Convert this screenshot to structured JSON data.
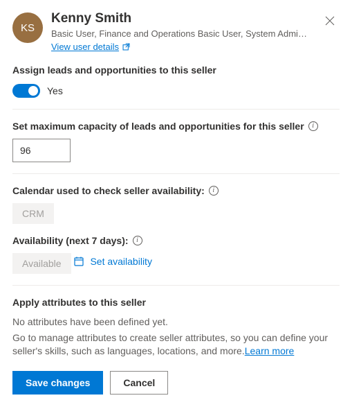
{
  "header": {
    "avatar_initials": "KS",
    "user_name": "Kenny Smith",
    "user_roles": "Basic User, Finance and Operations Basic User, System Administr…",
    "view_details_label": "View user details"
  },
  "assign": {
    "label": "Assign leads and opportunities to this seller",
    "toggle_value": "Yes"
  },
  "capacity": {
    "label": "Set maximum capacity of leads and opportunities for this seller",
    "value": "96"
  },
  "calendar": {
    "label": "Calendar used to check seller availability:",
    "value": "CRM"
  },
  "availability": {
    "label": "Availability (next 7 days):",
    "value": "Available",
    "set_label": "Set availability"
  },
  "attributes": {
    "label": "Apply attributes to this seller",
    "empty_text": "No attributes have been defined yet.",
    "help_text": "Go to manage attributes to create seller attributes, so you can define your seller's skills, such as languages, locations, and more.",
    "learn_more": "Learn more"
  },
  "buttons": {
    "save": "Save changes",
    "cancel": "Cancel"
  }
}
